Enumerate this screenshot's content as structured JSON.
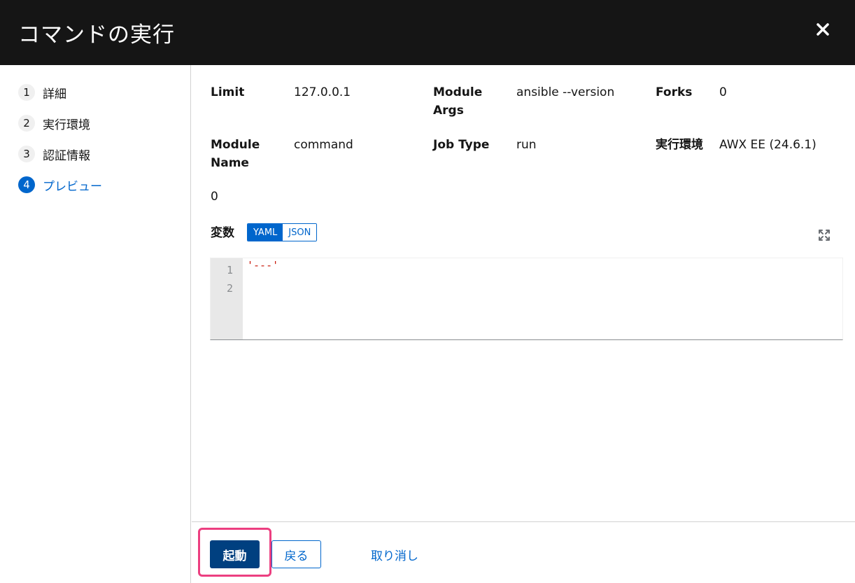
{
  "dialog": {
    "title": "コマンドの実行",
    "close_icon": "close-icon"
  },
  "wizard_nav": [
    {
      "number": "1",
      "label": "詳細",
      "active": false
    },
    {
      "number": "2",
      "label": "実行環境",
      "active": false
    },
    {
      "number": "3",
      "label": "認証情報",
      "active": false
    },
    {
      "number": "4",
      "label": "プレビュー",
      "active": true
    }
  ],
  "details": {
    "limit": {
      "term": "Limit",
      "value": "127.0.0.1"
    },
    "module_args": {
      "term": "Module Args",
      "value": "ansible --version"
    },
    "forks": {
      "term": "Forks",
      "value": "0"
    },
    "module_name": {
      "term": "Module Name",
      "value": "command"
    },
    "job_type": {
      "term": "Job Type",
      "value": "run"
    },
    "execution_env": {
      "term": "実行環境",
      "value": "AWX EE (24.6.1)"
    },
    "extra_value": "0"
  },
  "variables": {
    "label": "変数",
    "toggle": [
      "YAML",
      "JSON"
    ],
    "selected": "YAML",
    "line_numbers": [
      "1",
      "2"
    ],
    "code_lines": [
      "'---'",
      ""
    ]
  },
  "footer": {
    "launch_label": "起動",
    "back_label": "戻る",
    "cancel_label": "取り消し"
  },
  "colors": {
    "header_bg": "#151515",
    "primary": "#004080",
    "link": "#0066cc",
    "highlight": "#ec3f80"
  }
}
